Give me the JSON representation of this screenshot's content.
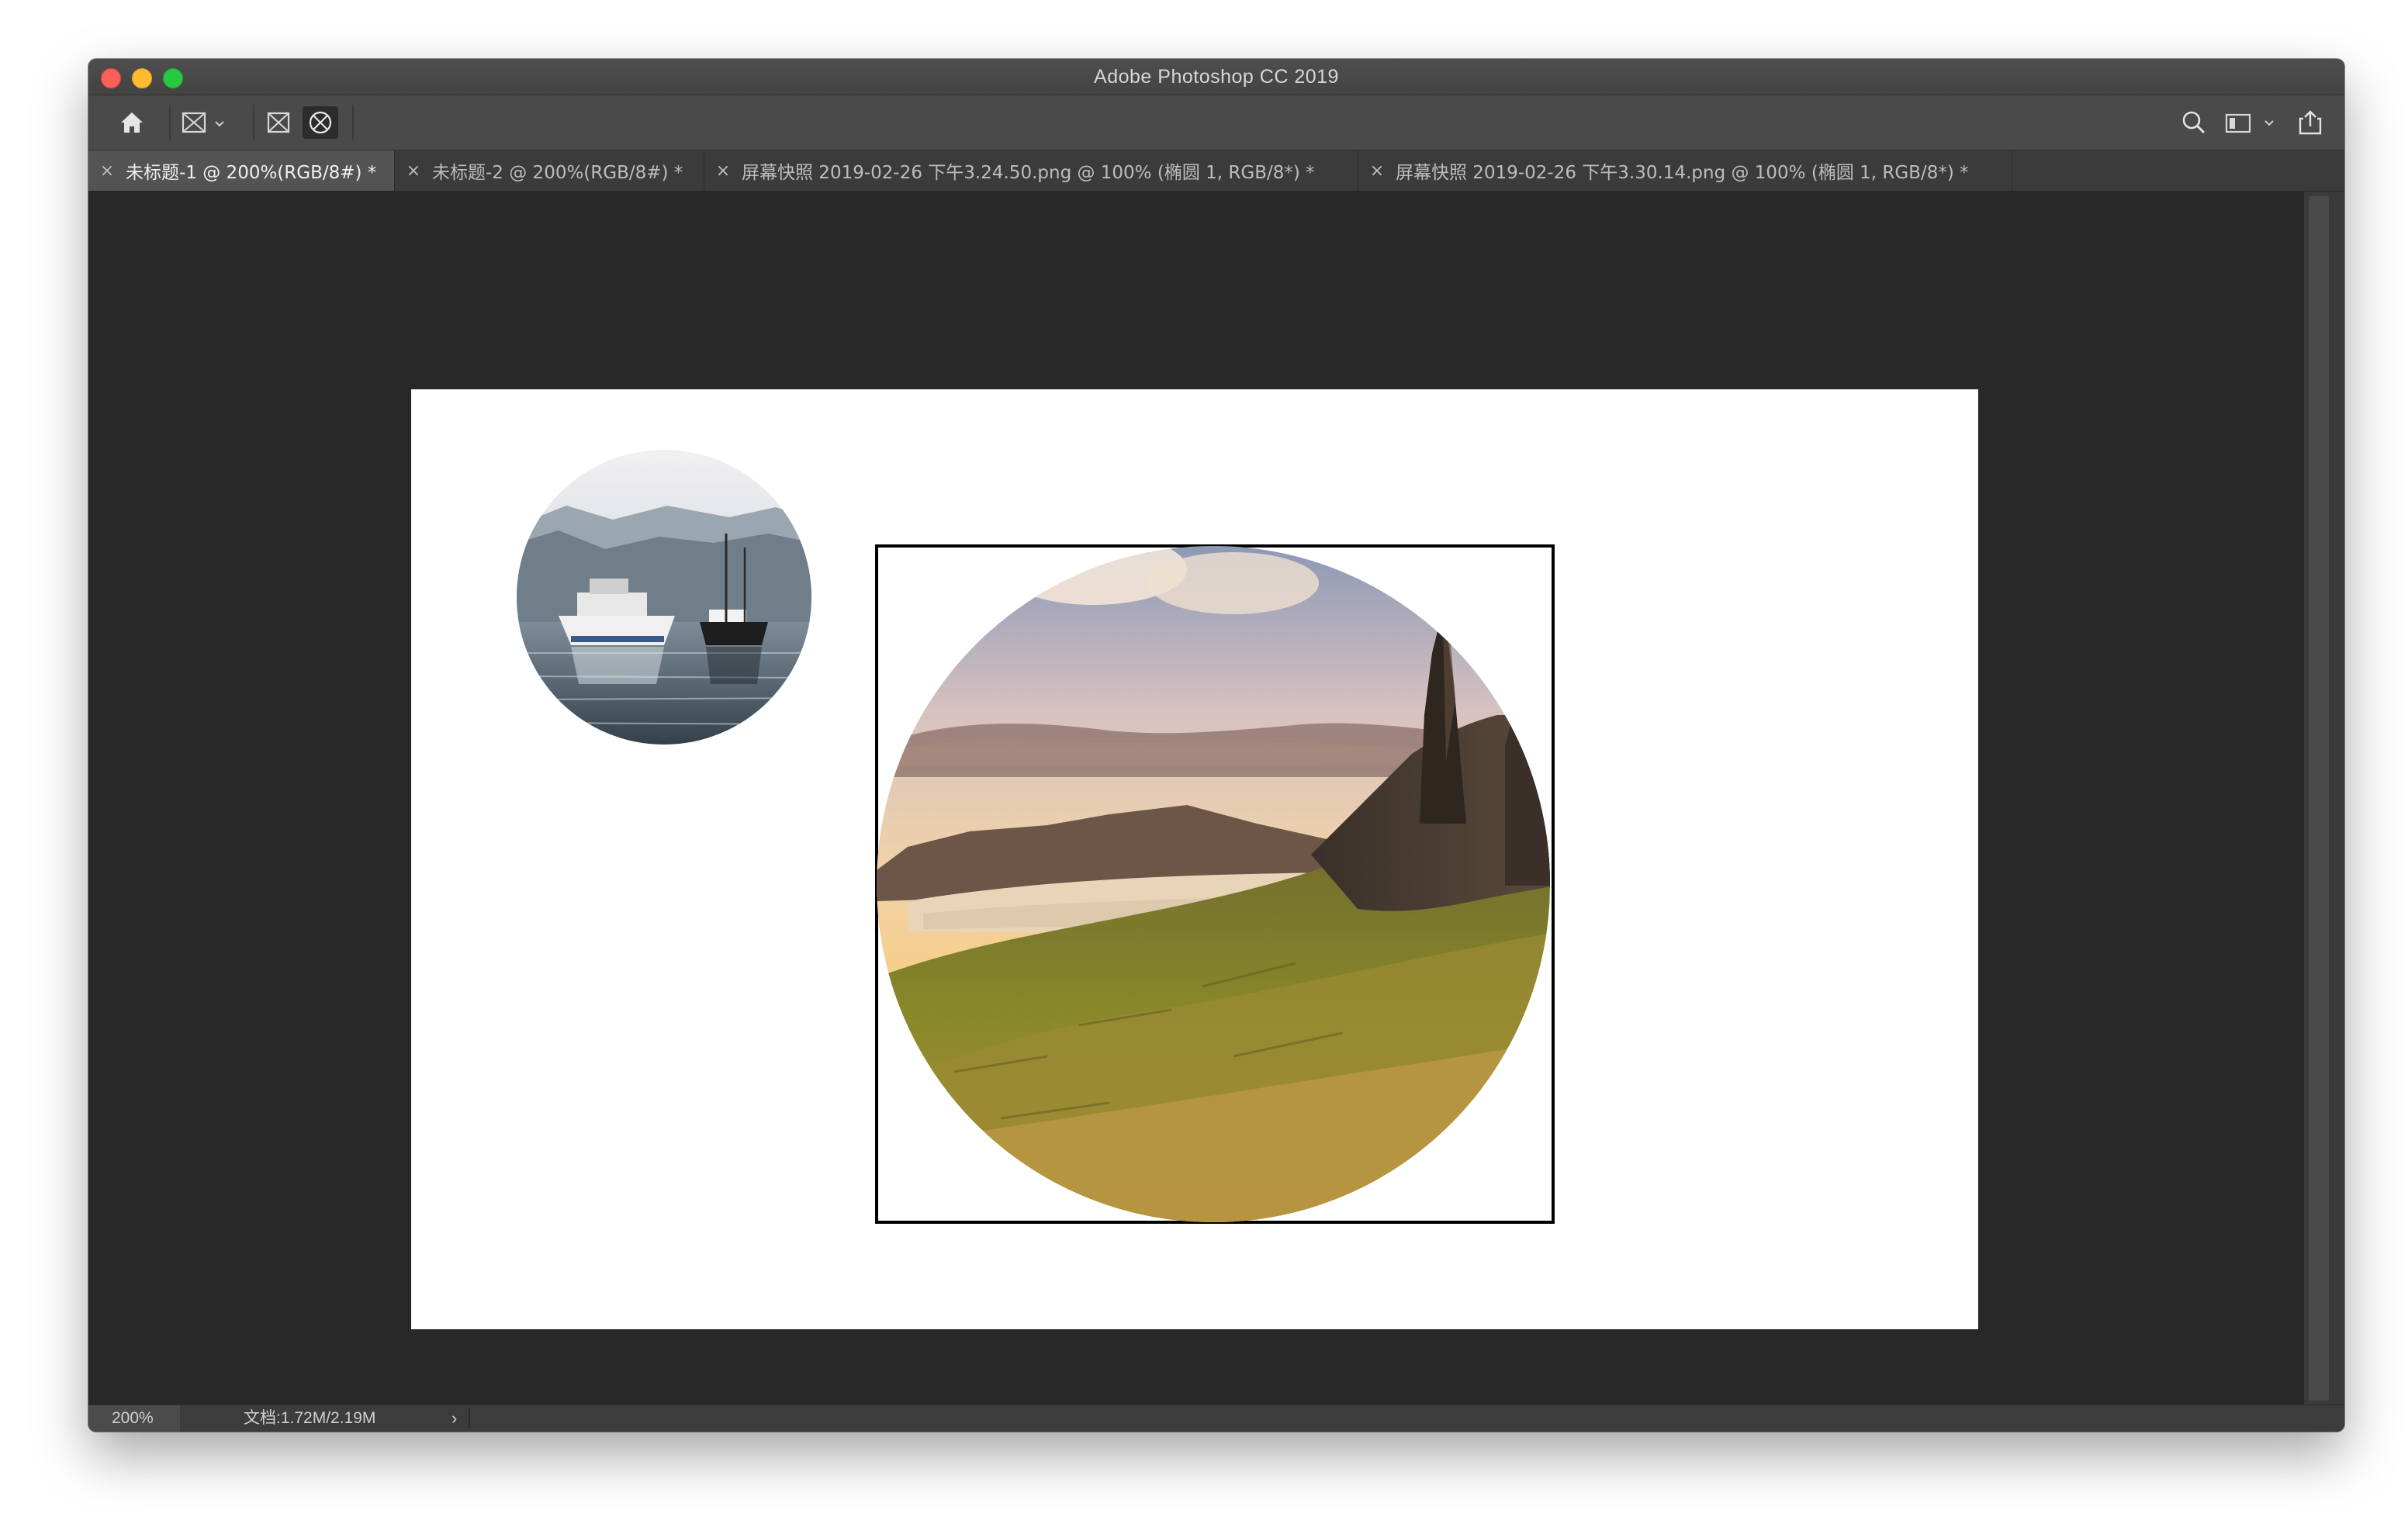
{
  "window": {
    "title": "Adobe Photoshop CC 2019"
  },
  "toolbar": {
    "home_icon": "home-icon",
    "frame_tool_icon": "frame-tool-icon",
    "rect_frame_icon": "rectangular-frame-icon",
    "ellipse_frame_icon": "elliptical-frame-icon",
    "search_icon": "search-icon",
    "workspace_icon": "workspace-switcher-icon",
    "share_icon": "share-icon"
  },
  "tabs": [
    {
      "label": "未标题-1 @ 200%(RGB/8#) *",
      "active": true
    },
    {
      "label": "未标题-2 @ 200%(RGB/8#) *",
      "active": false
    },
    {
      "label": "屏幕快照 2019-02-26 下午3.24.50.png @ 100% (椭圆 1, RGB/8*) *",
      "active": false
    },
    {
      "label": "屏幕快照 2019-02-26 下午3.30.14.png @ 100% (椭圆 1, RGB/8*) *",
      "active": false
    }
  ],
  "tab_close_glyph": "×",
  "canvas": {
    "background": "#ffffff",
    "frame_border_color": "#000000",
    "images": [
      "boats-photo",
      "mountain-photo"
    ]
  },
  "status": {
    "zoom": "200%",
    "doc_info": "文档:1.72M/2.19M",
    "arrow": "›"
  },
  "colors": {
    "workspace": "#282828",
    "toolbar": "#4a4a4a",
    "tabbar": "#3b3b3b",
    "active_tab": "#535353"
  }
}
